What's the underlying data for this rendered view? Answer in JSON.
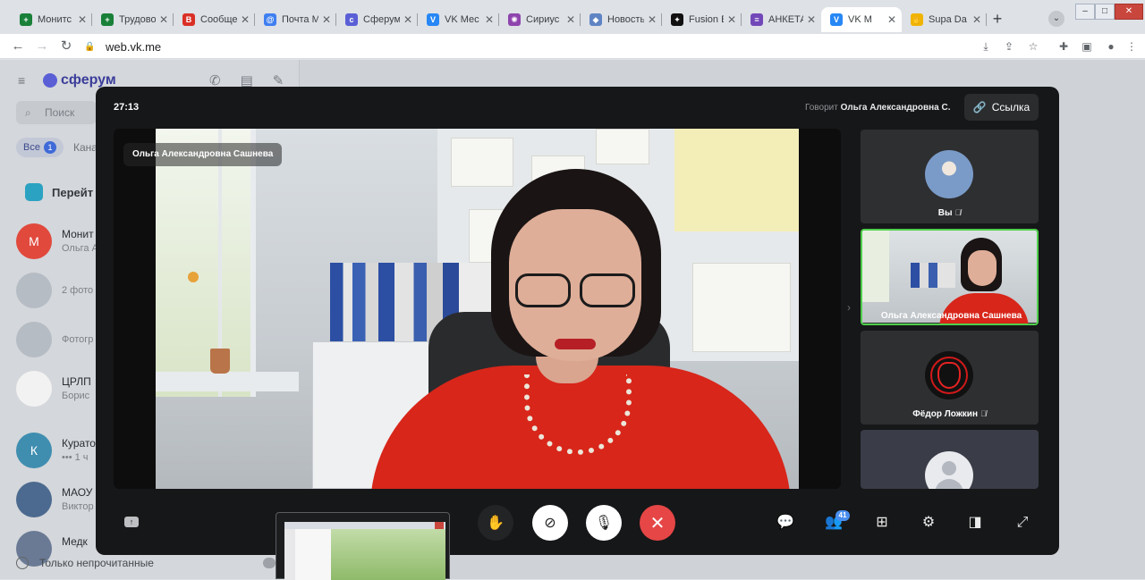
{
  "browser": {
    "tabs": [
      {
        "title": "Монитс",
        "fav_color": "#188038",
        "fav_glyph": "+"
      },
      {
        "title": "Трудово",
        "fav_color": "#188038",
        "fav_glyph": "+"
      },
      {
        "title": "Сообще",
        "fav_color": "#d93025",
        "fav_glyph": "B"
      },
      {
        "title": "Почта М",
        "fav_color": "#3f7ff0",
        "fav_glyph": "@"
      },
      {
        "title": "Сферум",
        "fav_color": "#5a5fd6",
        "fav_glyph": "с"
      },
      {
        "title": "VK Мес",
        "fav_color": "#2787f5",
        "fav_glyph": "V"
      },
      {
        "title": "Сириус",
        "fav_color": "#8e44ad",
        "fav_glyph": "✺"
      },
      {
        "title": "Новость",
        "fav_color": "#5f84c4",
        "fav_glyph": "◆"
      },
      {
        "title": "Fusion E",
        "fav_color": "#111111",
        "fav_glyph": "✦"
      },
      {
        "title": "АНКЕТА",
        "fav_color": "#7248b9",
        "fav_glyph": "≡"
      },
      {
        "title": "VK М",
        "fav_color": "#2787f5",
        "fav_glyph": "V"
      },
      {
        "title": "Supa Da",
        "fav_color": "#f0b400",
        "fav_glyph": "✋"
      }
    ],
    "url": "web.vk.me"
  },
  "sidebar": {
    "logo": "сферум",
    "search_placeholder": "Поиск",
    "filter_all": "Все",
    "filter_all_count": "1",
    "filter_next": "Кана",
    "go_label": "Перейт",
    "chats": [
      {
        "initial": "М",
        "name": "Монит",
        "sub": "Ольга А",
        "color": "#e0493c"
      },
      {
        "initial": "",
        "name": "",
        "sub": "2 фото",
        "color": "#b6bcc4"
      },
      {
        "initial": "",
        "name": "",
        "sub": "Фотогр",
        "color": "#b6bcc4"
      },
      {
        "initial": "",
        "name": "ЦРЛП",
        "sub": "Борис",
        "color": "#f2f2f2"
      },
      {
        "initial": "К",
        "name": "Курато",
        "sub": "••• 1 ч",
        "color": "#3f8eb0"
      },
      {
        "initial": "",
        "name": "МАОУ",
        "sub": "Виктор",
        "color": "#4c6a8f"
      },
      {
        "initial": "",
        "name": "Медк",
        "sub": "",
        "color": "#6a7a94"
      }
    ],
    "bottom_label": "Только непрочитанные"
  },
  "call": {
    "timer": "27:13",
    "speaker_prefix": "Говорит",
    "speaker_name": "Ольга Александровна С.",
    "link_label": "Ссылка",
    "main_label": "Ольга Александровна Сашнева",
    "participants": [
      {
        "name": "Вы",
        "muted": true
      },
      {
        "name": "Ольга Александровна Сашнева",
        "muted": false,
        "active": true
      },
      {
        "name": "Фёдор Ложкин",
        "muted": true
      },
      {
        "name": "",
        "muted": false
      }
    ],
    "participants_count": "41"
  }
}
